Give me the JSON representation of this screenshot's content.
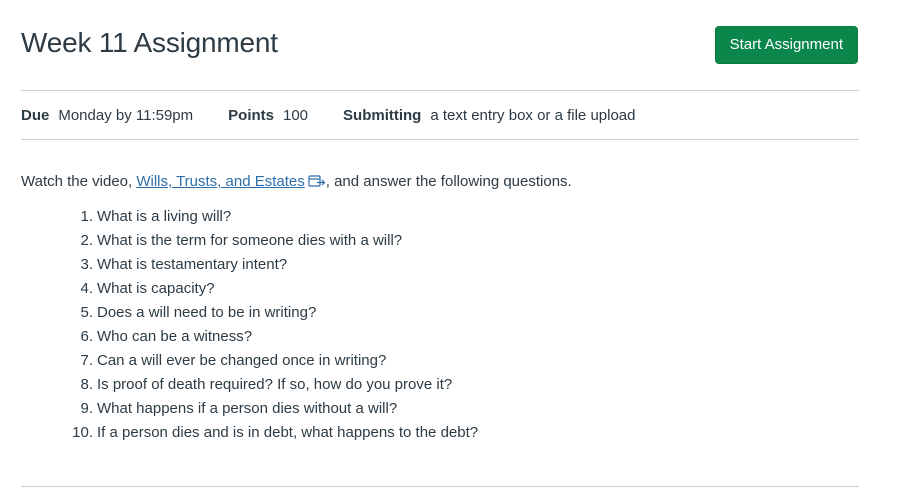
{
  "assignment": {
    "title": "Week 11 Assignment",
    "start_button_label": "Start Assignment"
  },
  "details": {
    "due_label": "Due",
    "due_value": "Monday by 11:59pm",
    "points_label": "Points",
    "points_value": "100",
    "submitting_label": "Submitting",
    "submitting_value": "a text entry box or a file upload"
  },
  "description": {
    "intro_before": "Watch the video, ",
    "video_link_text": "Wills, Trusts, and Estates",
    "intro_after": ", and answer the following questions.",
    "link_icon": "external-link-icon",
    "questions": [
      {
        "num": "1.",
        "text": "What is a living will?"
      },
      {
        "num": "2.",
        "text": "What is the term for someone dies with a will?"
      },
      {
        "num": "3.",
        "text": "What is testamentary intent?"
      },
      {
        "num": "4.",
        "text": "What is capacity?"
      },
      {
        "num": "5.",
        "text": "Does a will need to be in writing?"
      },
      {
        "num": "6.",
        "text": "Who can be a witness?"
      },
      {
        "num": "7.",
        "text": "Can a will ever be changed once in writing?"
      },
      {
        "num": "8.",
        "text": "Is proof of death required? If so, how do you prove it?"
      },
      {
        "num": "9.",
        "text": "What happens if a person dies without a will?"
      },
      {
        "num": "10.",
        "text": "If a person dies and is in debt, what happens to the debt?"
      }
    ]
  },
  "colors": {
    "text": "#2d3b45",
    "link": "#2d6ea8",
    "button_bg": "#0b874b",
    "button_text": "#ffffff",
    "divider": "#c7cdd1"
  }
}
